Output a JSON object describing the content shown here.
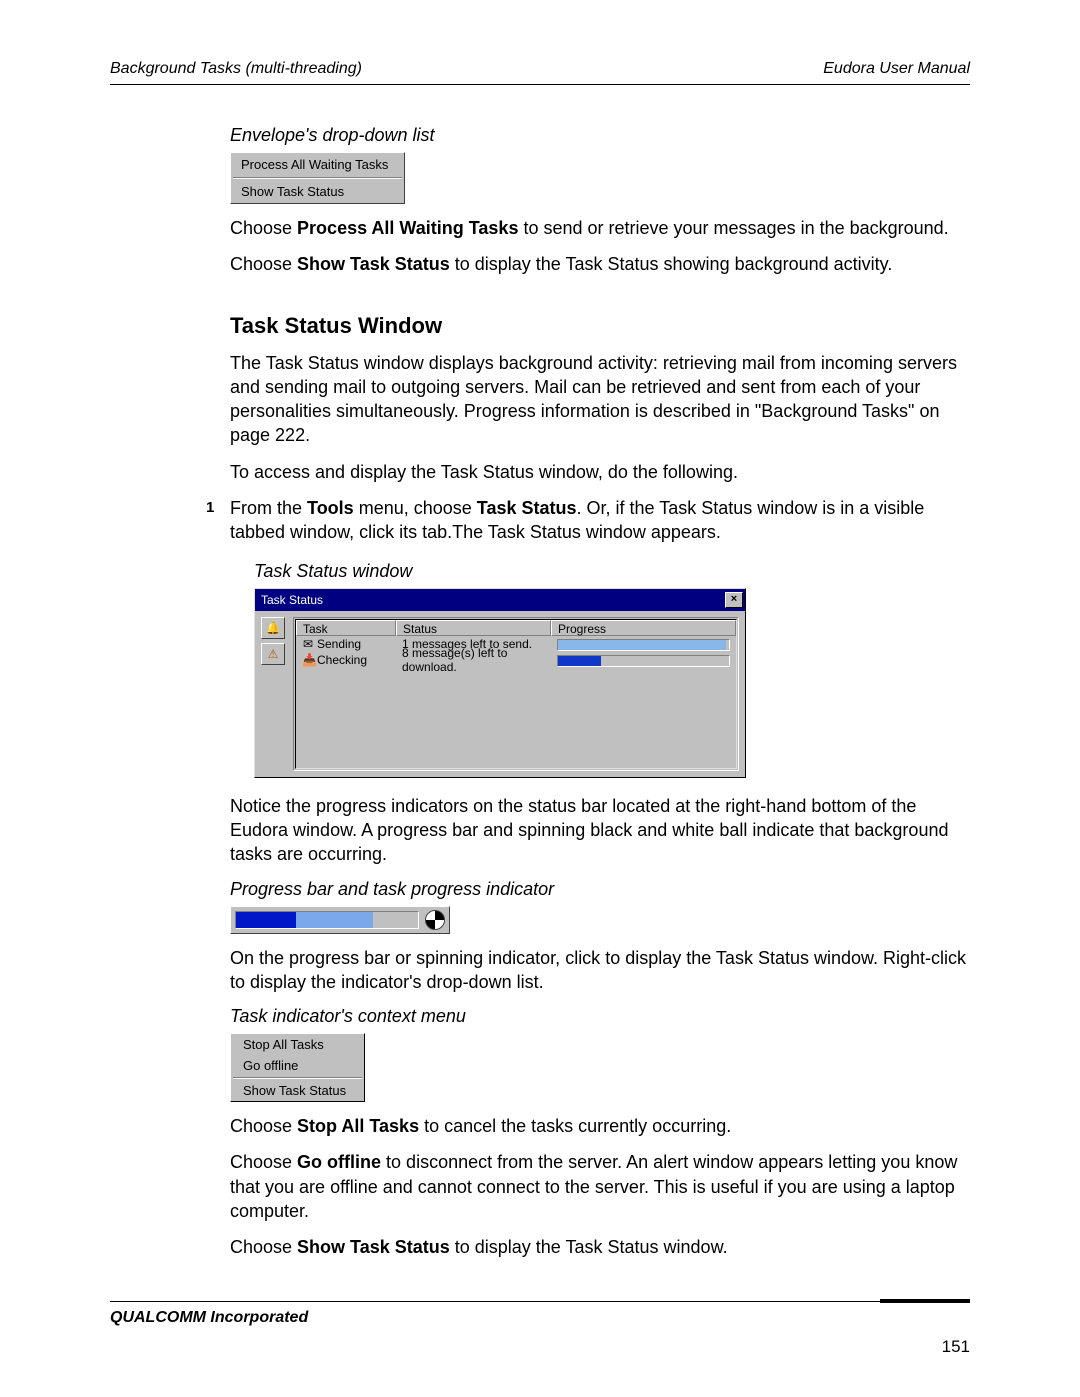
{
  "header": {
    "left": "Background Tasks (multi-threading)",
    "right": "Eudora User Manual"
  },
  "caption1": "Envelope's drop-down list",
  "envelopeMenu": [
    "Process All Waiting Tasks",
    "Show Task Status"
  ],
  "p1a": "Choose ",
  "p1b": "Process All Waiting Tasks",
  "p1c": " to send or retrieve your messages in the background.",
  "p2a": "Choose ",
  "p2b": "Show Task Status",
  "p2c": " to display the Task Status showing background activity.",
  "section": "Task Status Window",
  "p3": "The Task Status window displays background activity: retrieving mail from incoming servers and sending mail to outgoing servers. Mail can be retrieved and sent from each of your personalities simultaneously. Progress information is described in \"Background Tasks\" on page 222.",
  "p4": "To access and display the Task Status window, do the following.",
  "step1num": "1",
  "s1a": "From the ",
  "s1b": "Tools",
  "s1c": " menu, choose ",
  "s1d": "Task Status",
  "s1e": ". Or, if the Task Status window is in a visible tabbed window, click its tab.The Task Status window appears.",
  "caption2": "Task Status window",
  "tswin": {
    "title": "Task Status",
    "close": "×",
    "cols": {
      "task": "Task",
      "status": "Status",
      "progress": "Progress"
    },
    "rows": [
      {
        "icon": "✉",
        "task": "Sending",
        "status": "1 messages left to send.",
        "pw1": 98,
        "pw2": 0
      },
      {
        "icon": "📥",
        "task": "Checking",
        "status": "8 message(s) left to download.",
        "pw1": 25,
        "pw2": 25
      }
    ]
  },
  "p5": "Notice the progress indicators on the status bar located at the right-hand bottom of the Eudora window. A progress bar and spinning black and white ball indicate that background tasks are occurring.",
  "caption3": "Progress bar and task progress indicator",
  "p6": "On the progress bar or spinning indicator, click to display the Task Status window. Right-click to display the indicator's drop-down list.",
  "caption4": "Task indicator's context menu",
  "ctxMenu": [
    "Stop All Tasks",
    "Go offline",
    "Show Task Status"
  ],
  "p7a": "Choose ",
  "p7b": "Stop All Tasks",
  "p7c": " to cancel the tasks currently occurring.",
  "p8a": "Choose ",
  "p8b": "Go offline",
  "p8c": " to disconnect from the server. An alert window appears letting you know that you are offline and cannot connect to the server. This is useful if you are using a laptop computer.",
  "p9a": "Choose ",
  "p9b": "Show Task Status",
  "p9c": " to display the Task Status window.",
  "footer": "QUALCOMM Incorporated",
  "pageNumber": "151"
}
